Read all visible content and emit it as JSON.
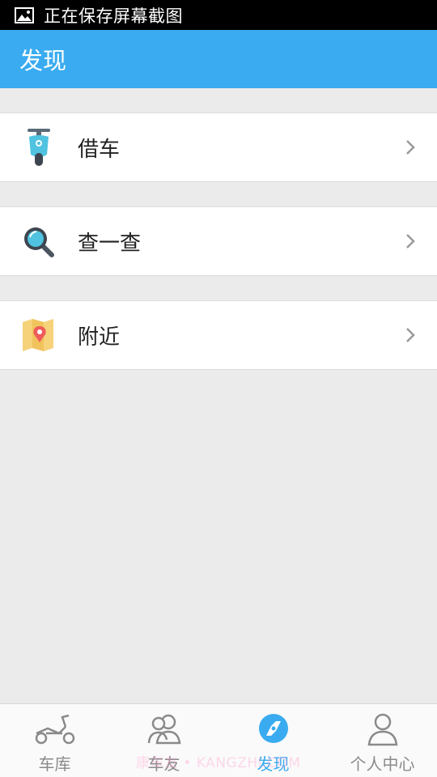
{
  "status_bar": {
    "text": "正在保存屏幕截图"
  },
  "app_bar": {
    "title": "发现"
  },
  "list": [
    {
      "label": "借车",
      "icon": "scooter-icon"
    },
    {
      "label": "查一查",
      "icon": "magnifier-icon"
    },
    {
      "label": "附近",
      "icon": "map-pin-icon"
    }
  ],
  "bottom_nav": [
    {
      "label": "车库",
      "icon": "scooter-outline-icon",
      "active": false
    },
    {
      "label": "车友",
      "icon": "friends-icon",
      "active": false
    },
    {
      "label": "发现",
      "icon": "compass-icon",
      "active": true
    },
    {
      "label": "个人中心",
      "icon": "person-icon",
      "active": false
    }
  ],
  "watermark": "康车友 • KANGZHI.COM",
  "colors": {
    "accent": "#3aabf0",
    "background": "#ebebeb",
    "inactive": "#8a8a8a"
  }
}
